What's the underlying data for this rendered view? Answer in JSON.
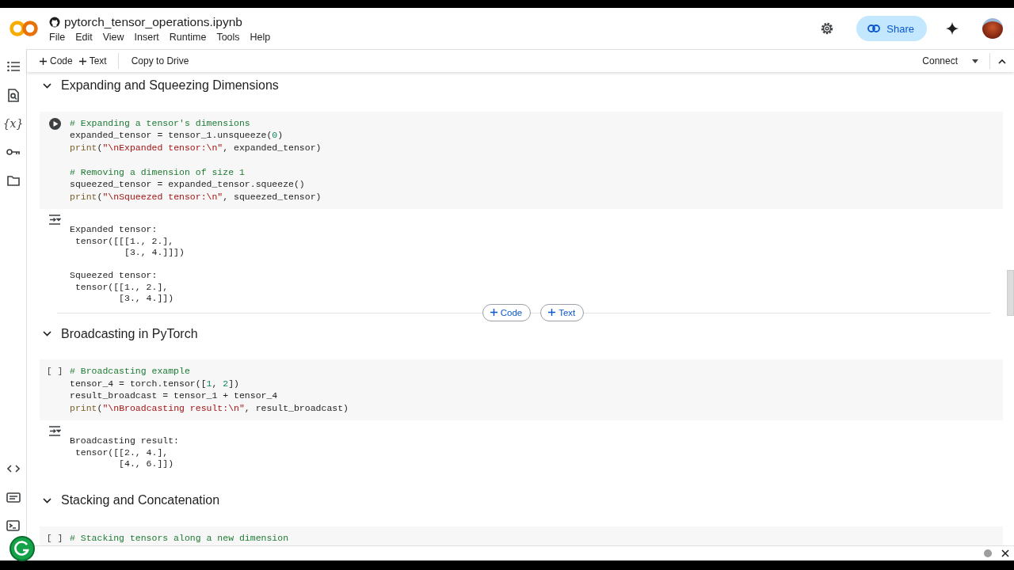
{
  "notebook": {
    "title": "pytorch_tensor_operations.ipynb",
    "menus": [
      "File",
      "Edit",
      "View",
      "Insert",
      "Runtime",
      "Tools",
      "Help"
    ]
  },
  "header_actions": {
    "share": "Share"
  },
  "toolbar": {
    "add_buttons": [
      "Code",
      "Text"
    ],
    "copy": "Copy to Drive",
    "connect": "Connect"
  },
  "sidebar": {
    "variables": "{x}"
  },
  "cells": [
    {
      "kind": "section",
      "title": "Expanding and Squeezing Dimensions",
      "expanded": true
    },
    {
      "kind": "code",
      "hovered": true,
      "blocks": [
        [
          [
            {
              "kind": "comment",
              "text": "# Expanding a tensor's dimensions"
            }
          ],
          [
            {
              "kind": "plain",
              "text": "expanded_tensor = tensor_1.unsqueeze("
            },
            {
              "kind": "number",
              "text": "0"
            },
            {
              "kind": "plain",
              "text": ")"
            }
          ],
          [
            {
              "kind": "func",
              "text": "print"
            },
            {
              "kind": "plain",
              "text": "("
            },
            {
              "kind": "string",
              "text": "\"\\nExpanded tensor:\\n\""
            },
            {
              "kind": "plain",
              "text": ", expanded_tensor)"
            }
          ]
        ],
        [
          [
            {
              "kind": "comment",
              "text": "# Removing a dimension of size 1"
            }
          ],
          [
            {
              "kind": "plain",
              "text": "squeezed_tensor = expanded_tensor.squeeze()"
            }
          ],
          [
            {
              "kind": "func",
              "text": "print"
            },
            {
              "kind": "plain",
              "text": "("
            },
            {
              "kind": "string",
              "text": "\"\\nSqueezed tensor:\\n\""
            },
            {
              "kind": "plain",
              "text": ", squeezed_tensor)"
            }
          ]
        ]
      ],
      "output": [
        [
          "Expanded tensor:",
          " tensor([[[1., 2.],",
          "          [3., 4.]]])"
        ],
        [
          "Squeezed tensor:",
          " tensor([[1., 2.],",
          "         [3., 4.]])"
        ]
      ]
    },
    {
      "kind": "add_bar",
      "buttons": [
        "Code",
        "Text"
      ]
    },
    {
      "kind": "section",
      "title": "Broadcasting in PyTorch",
      "expanded": true
    },
    {
      "kind": "code",
      "hovered": false,
      "prompt": "[ ]",
      "blocks": [
        [
          [
            {
              "kind": "comment",
              "text": "# Broadcasting example"
            }
          ],
          [
            {
              "kind": "plain",
              "text": "tensor_4 = torch.tensor(["
            },
            {
              "kind": "number",
              "text": "1"
            },
            {
              "kind": "plain",
              "text": ", "
            },
            {
              "kind": "number",
              "text": "2"
            },
            {
              "kind": "plain",
              "text": "])"
            }
          ],
          [
            {
              "kind": "plain",
              "text": "result_broadcast = tensor_1 + tensor_4"
            }
          ],
          [
            {
              "kind": "func",
              "text": "print"
            },
            {
              "kind": "plain",
              "text": "("
            },
            {
              "kind": "string",
              "text": "\"\\nBroadcasting result:\\n\""
            },
            {
              "kind": "plain",
              "text": ", result_broadcast)"
            }
          ]
        ]
      ],
      "output": [
        [
          "Broadcasting result:",
          " tensor([[2., 4.],",
          "         [4., 6.]])"
        ]
      ]
    },
    {
      "kind": "section",
      "title": "Stacking and Concatenation",
      "expanded": true
    },
    {
      "kind": "code",
      "hovered": false,
      "prompt": "[ ]",
      "blocks": [
        [
          [
            {
              "kind": "comment",
              "text": "# Stacking tensors along a new dimension"
            }
          ]
        ]
      ]
    }
  ]
}
